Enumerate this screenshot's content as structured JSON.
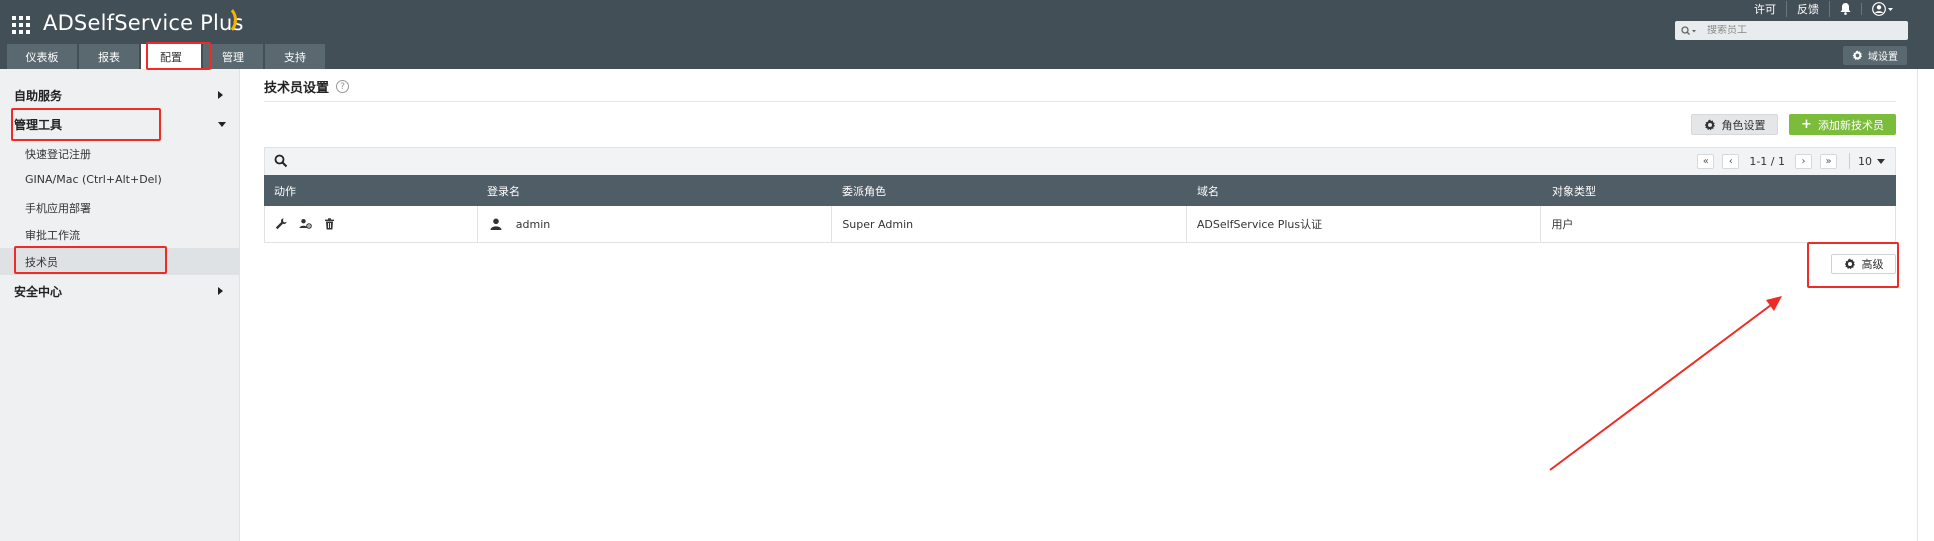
{
  "app": {
    "title": "ADSelfService Plus"
  },
  "header": {
    "links": [
      "许可",
      "反馈"
    ],
    "search_placeholder": "搜索员工",
    "domain_settings_label": "域设置"
  },
  "tabs": [
    {
      "label": "仪表板",
      "active": false
    },
    {
      "label": "报表",
      "active": false
    },
    {
      "label": "配置",
      "active": true
    },
    {
      "label": "管理",
      "active": false
    },
    {
      "label": "支持",
      "active": false
    }
  ],
  "sidebar": {
    "groups": [
      {
        "label": "自助服务",
        "expanded": false
      },
      {
        "label": "管理工具",
        "expanded": true
      },
      {
        "label": "安全中心",
        "expanded": false
      }
    ],
    "items": [
      {
        "label": "快速登记注册",
        "selected": false
      },
      {
        "label": "GINA/Mac (Ctrl+Alt+Del)",
        "selected": false
      },
      {
        "label": "手机应用部署",
        "selected": false
      },
      {
        "label": "审批工作流",
        "selected": false
      },
      {
        "label": "技术员",
        "selected": true
      }
    ]
  },
  "main": {
    "title": "技术员设置",
    "help_icon": "?",
    "role_settings_label": "角色设置",
    "add_technician_label": "添加新技术员",
    "advanced_label": "高级"
  },
  "pager": {
    "range": "1-1 / 1",
    "page_size": "10"
  },
  "table": {
    "columns": [
      "动作",
      "登录名",
      "委派角色",
      "域名",
      "对象类型"
    ],
    "rows": [
      {
        "login": "admin",
        "role": "Super Admin",
        "domain": "ADSelfService Plus认证",
        "object_type": "用户"
      }
    ]
  },
  "colors": {
    "header_bg": "#434f57",
    "accent_green": "#7cbc3b",
    "annotation_red": "#ee2b24"
  }
}
